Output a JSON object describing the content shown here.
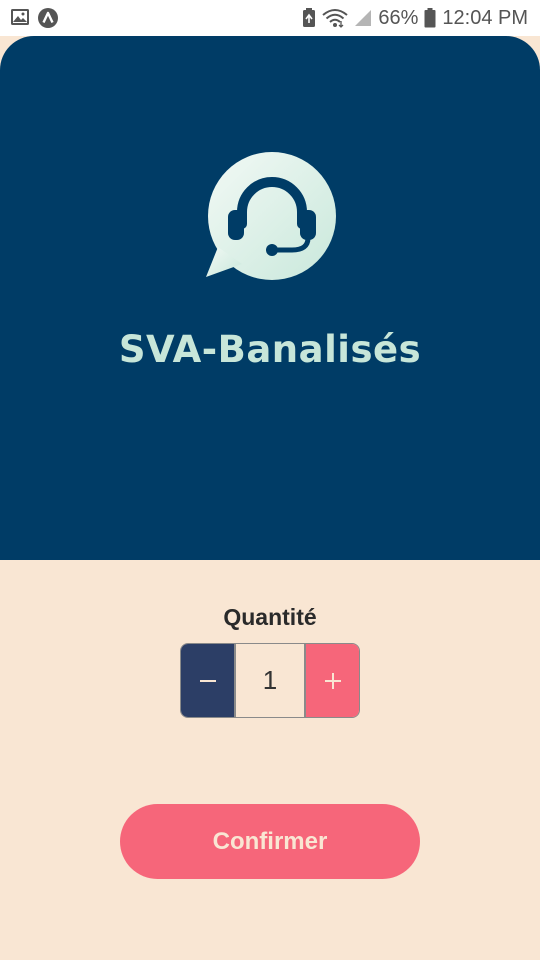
{
  "status_bar": {
    "left_icons": [
      "image-icon",
      "app-notification-icon"
    ],
    "battery_percent": "66%",
    "time": "12:04 PM"
  },
  "header": {
    "title": "SVA-Banalisés",
    "logo_icon": "headset-chat-icon"
  },
  "quantity": {
    "label": "Quantité",
    "value": "1",
    "minus_label": "−",
    "plus_label": "+"
  },
  "confirm_button": {
    "label": "Confirmer"
  },
  "colors": {
    "header_background": "#003c66",
    "page_background": "#f9e6d3",
    "accent": "#f6667a",
    "stepper_minus": "#2c3e66",
    "title_text": "#c7e6d9"
  }
}
